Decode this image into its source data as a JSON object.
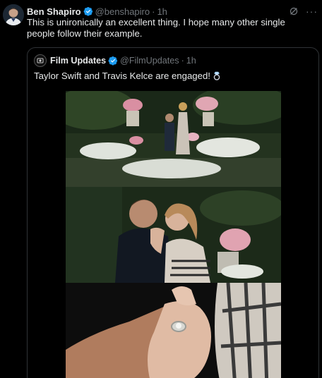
{
  "tweet": {
    "author_name": "Ben Shapiro",
    "author_handle": "@benshapiro",
    "separator": "·",
    "time": "1h",
    "text": "This is unironically an excellent thing. I hope many other single people follow their example.",
    "icons": [
      "avatar",
      "verified-badge-icon",
      "grok-icon",
      "more-icon"
    ]
  },
  "quoted": {
    "author_name": "Film Updates",
    "author_handle": "@FilmUpdates",
    "separator": "·",
    "time": "1h",
    "text": "Taylor Swift and Travis Kelce are engaged!",
    "emoji": "ring-emoji",
    "media": [
      "garden-proposal-photo",
      "couple-embrace-photo",
      "engagement-ring-photo"
    ]
  },
  "colors": {
    "background": "#000000",
    "text": "#e7e9ea",
    "muted": "#71767b",
    "border": "#2f3336",
    "verified": "#1d9bf0"
  }
}
